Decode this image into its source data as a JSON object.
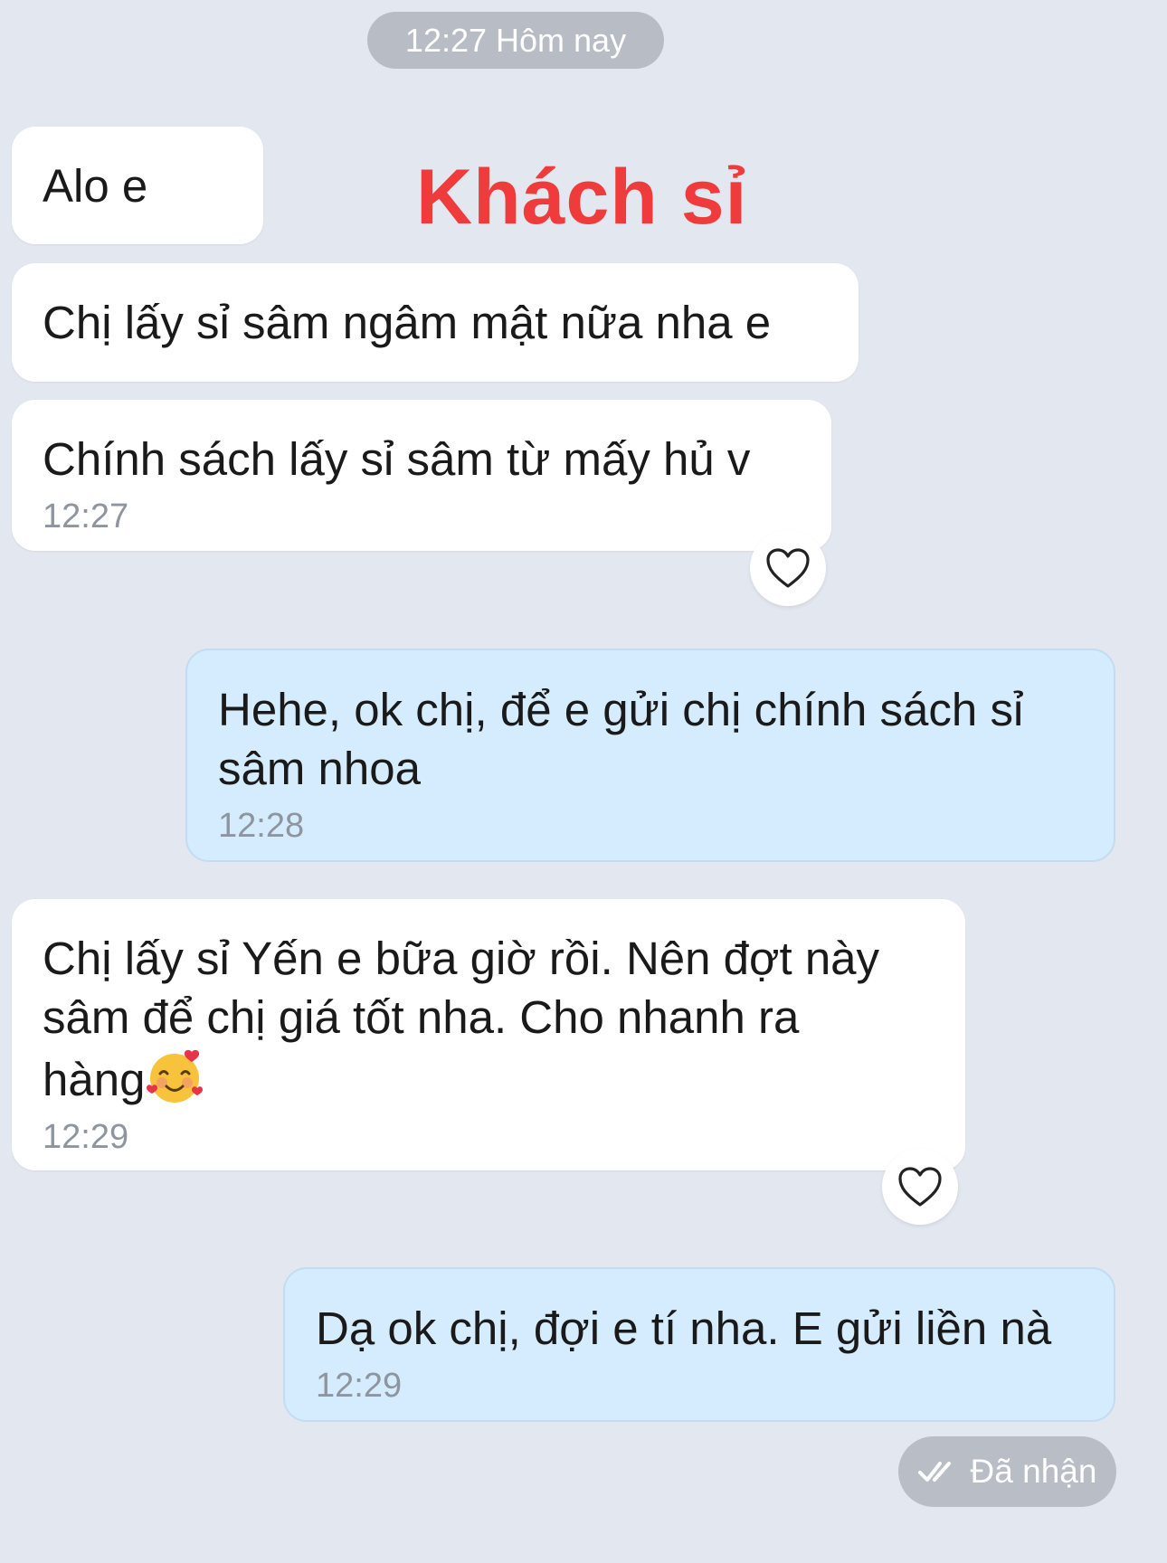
{
  "date_divider": "12:27 Hôm nay",
  "overlay_label": "Khách sỉ",
  "messages": [
    {
      "side": "in",
      "text": "Alo e",
      "time": ""
    },
    {
      "side": "in",
      "text": "Chị lấy sỉ sâm ngâm mật nữa nha e",
      "time": ""
    },
    {
      "side": "in",
      "text": "Chính sách lấy sỉ sâm từ mấy hủ v",
      "time": "12:27"
    },
    {
      "side": "out",
      "text": "Hehe, ok chị, để e gửi chị chính sách sỉ sâm nhoa",
      "time": "12:28"
    },
    {
      "side": "in",
      "text": "Chị lấy sỉ Yến e bữa giờ rồi. Nên đợt này sâm để chị giá tốt nha. Cho nhanh ra hàng",
      "emoji": "smiling-face-with-hearts",
      "time": "12:29"
    },
    {
      "side": "out",
      "text": "Dạ ok chị, đợi e tí nha. E gửi liền nà",
      "time": "12:29"
    }
  ],
  "icons": {
    "heart": "heart-outline-icon",
    "double_check": "double-check-icon"
  },
  "status": {
    "received_label": "Đã nhận"
  },
  "colors": {
    "background": "#e2e7f0",
    "incoming_bubble": "#ffffff",
    "outgoing_bubble": "#d5ecff",
    "overlay_label": "#ef3b3b",
    "pill": "#b8bdc5"
  }
}
